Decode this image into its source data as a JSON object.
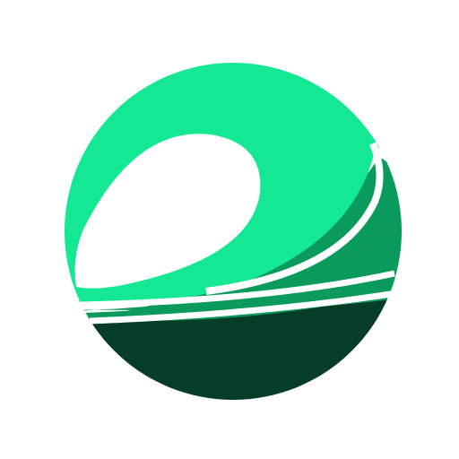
{
  "logo": {
    "icon": "green-wave-sphere-logo",
    "colors": {
      "top_wave": "#14e895",
      "middle_band": "#0a9a5c",
      "bottom_band": "#063d27",
      "background": "#ffffff"
    }
  }
}
